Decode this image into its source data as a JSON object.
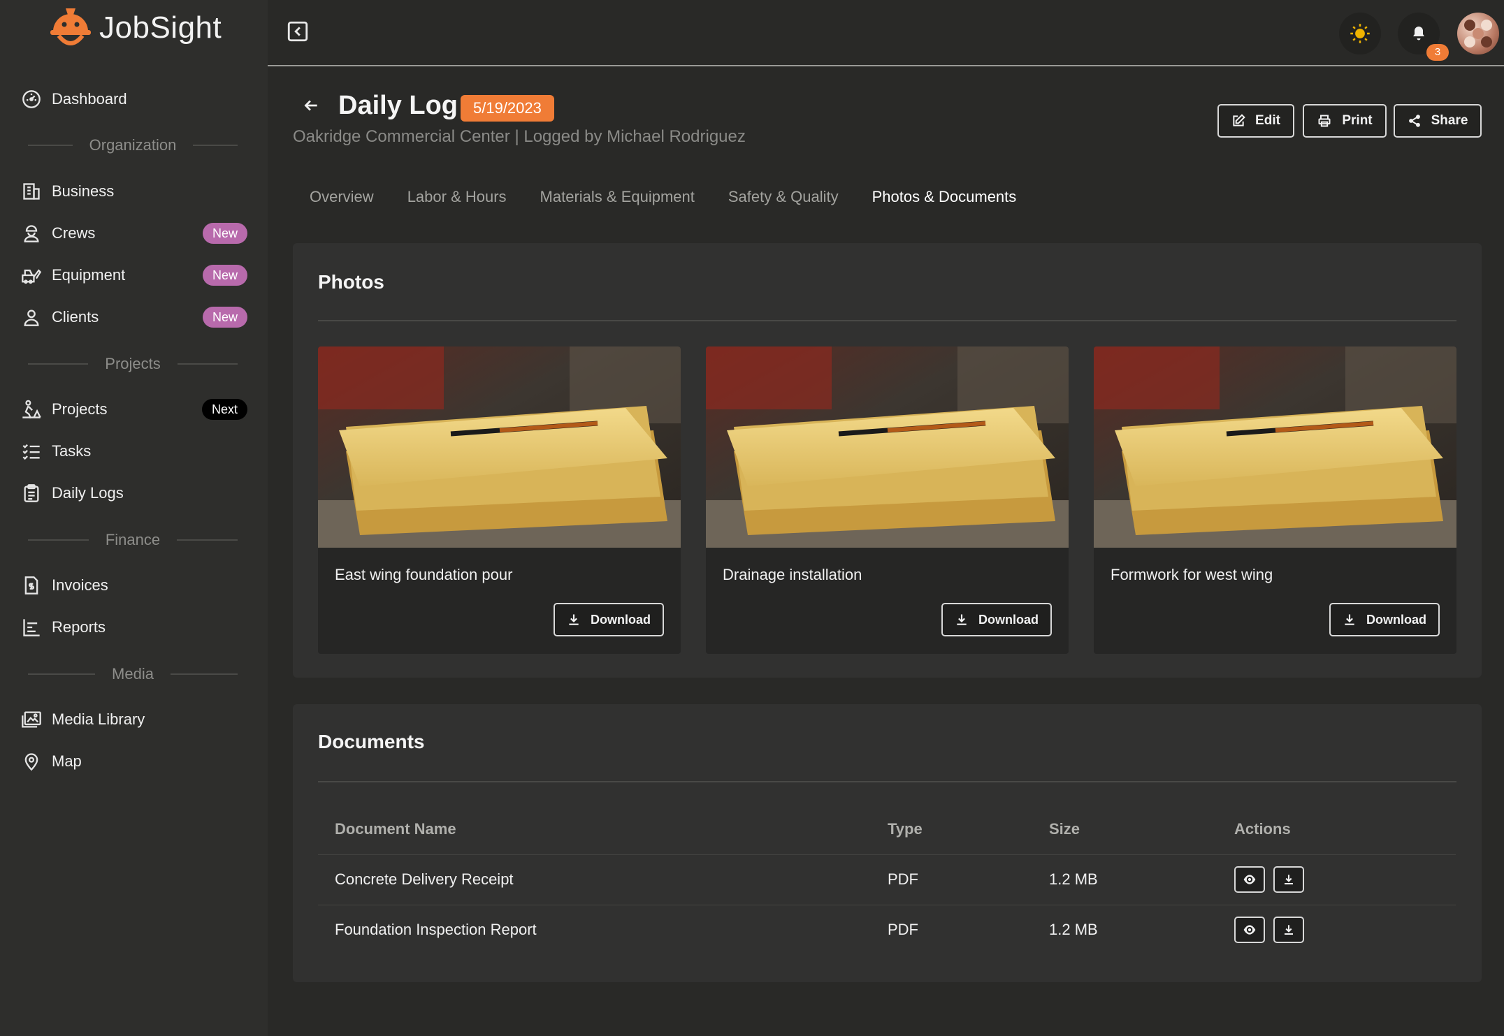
{
  "app": {
    "name": "JobSight"
  },
  "colors": {
    "accent": "#f07c36",
    "badge_new": "#b86aac",
    "background": "#292927"
  },
  "sidebar": {
    "items_top": [
      {
        "label": "Dashboard",
        "icon": "dashboard-gauge-icon"
      }
    ],
    "sections": [
      {
        "title": "Organization",
        "items": [
          {
            "label": "Business",
            "icon": "building-icon"
          },
          {
            "label": "Crews",
            "icon": "hard-hat-worker-icon",
            "badge": "New"
          },
          {
            "label": "Equipment",
            "icon": "equipment-icon",
            "badge": "New"
          },
          {
            "label": "Clients",
            "icon": "user-icon",
            "badge": "New"
          }
        ]
      },
      {
        "title": "Projects",
        "items": [
          {
            "label": "Projects",
            "icon": "construction-worker-icon",
            "badge": "Next"
          },
          {
            "label": "Tasks",
            "icon": "checklist-icon"
          },
          {
            "label": "Daily Logs",
            "icon": "clipboard-icon"
          }
        ]
      },
      {
        "title": "Finance",
        "items": [
          {
            "label": "Invoices",
            "icon": "invoice-icon"
          },
          {
            "label": "Reports",
            "icon": "bar-chart-icon"
          }
        ]
      },
      {
        "title": "Media",
        "items": [
          {
            "label": "Media Library",
            "icon": "image-gallery-icon"
          },
          {
            "label": "Map",
            "icon": "map-pin-icon"
          }
        ]
      }
    ]
  },
  "topbar": {
    "notification_count": "3",
    "theme_icon": "sun-icon",
    "notification_icon": "bell-icon"
  },
  "header": {
    "title": "Daily Log",
    "date": "5/19/2023",
    "subtitle": "Oakridge Commercial Center | Logged by Michael Rodriguez",
    "buttons": {
      "edit": "Edit",
      "print": "Print",
      "share": "Share"
    }
  },
  "tabs": [
    "Overview",
    "Labor & Hours",
    "Materials & Equipment",
    "Safety & Quality",
    "Photos & Documents"
  ],
  "active_tab": "Photos & Documents",
  "photos": {
    "title": "Photos",
    "download_label": "Download",
    "items": [
      {
        "caption": "East wing foundation pour"
      },
      {
        "caption": "Drainage installation"
      },
      {
        "caption": "Formwork for west wing"
      }
    ]
  },
  "documents": {
    "title": "Documents",
    "columns": [
      "Document Name",
      "Type",
      "Size",
      "Actions"
    ],
    "rows": [
      {
        "name": "Concrete Delivery Receipt",
        "type": "PDF",
        "size": "1.2 MB"
      },
      {
        "name": "Foundation Inspection Report",
        "type": "PDF",
        "size": "1.2 MB"
      }
    ]
  }
}
